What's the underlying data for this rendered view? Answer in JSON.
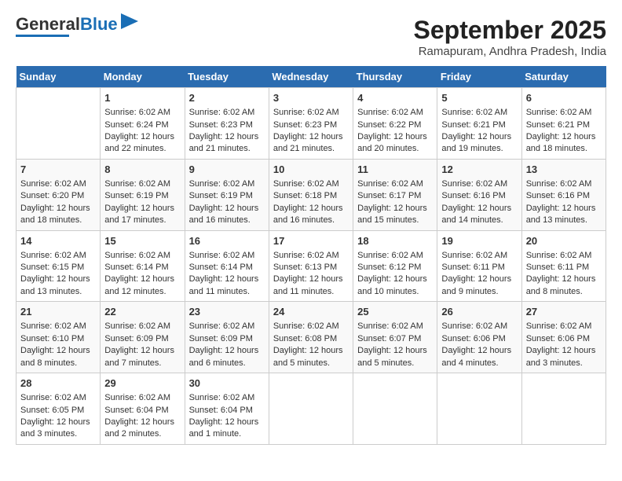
{
  "header": {
    "logo_general": "General",
    "logo_blue": "Blue",
    "title": "September 2025",
    "subtitle": "Ramapuram, Andhra Pradesh, India"
  },
  "days_of_week": [
    "Sunday",
    "Monday",
    "Tuesday",
    "Wednesday",
    "Thursday",
    "Friday",
    "Saturday"
  ],
  "weeks": [
    [
      {
        "day": "",
        "content": ""
      },
      {
        "day": "1",
        "content": "Sunrise: 6:02 AM\nSunset: 6:24 PM\nDaylight: 12 hours\nand 22 minutes."
      },
      {
        "day": "2",
        "content": "Sunrise: 6:02 AM\nSunset: 6:23 PM\nDaylight: 12 hours\nand 21 minutes."
      },
      {
        "day": "3",
        "content": "Sunrise: 6:02 AM\nSunset: 6:23 PM\nDaylight: 12 hours\nand 21 minutes."
      },
      {
        "day": "4",
        "content": "Sunrise: 6:02 AM\nSunset: 6:22 PM\nDaylight: 12 hours\nand 20 minutes."
      },
      {
        "day": "5",
        "content": "Sunrise: 6:02 AM\nSunset: 6:21 PM\nDaylight: 12 hours\nand 19 minutes."
      },
      {
        "day": "6",
        "content": "Sunrise: 6:02 AM\nSunset: 6:21 PM\nDaylight: 12 hours\nand 18 minutes."
      }
    ],
    [
      {
        "day": "7",
        "content": "Sunrise: 6:02 AM\nSunset: 6:20 PM\nDaylight: 12 hours\nand 18 minutes."
      },
      {
        "day": "8",
        "content": "Sunrise: 6:02 AM\nSunset: 6:19 PM\nDaylight: 12 hours\nand 17 minutes."
      },
      {
        "day": "9",
        "content": "Sunrise: 6:02 AM\nSunset: 6:19 PM\nDaylight: 12 hours\nand 16 minutes."
      },
      {
        "day": "10",
        "content": "Sunrise: 6:02 AM\nSunset: 6:18 PM\nDaylight: 12 hours\nand 16 minutes."
      },
      {
        "day": "11",
        "content": "Sunrise: 6:02 AM\nSunset: 6:17 PM\nDaylight: 12 hours\nand 15 minutes."
      },
      {
        "day": "12",
        "content": "Sunrise: 6:02 AM\nSunset: 6:16 PM\nDaylight: 12 hours\nand 14 minutes."
      },
      {
        "day": "13",
        "content": "Sunrise: 6:02 AM\nSunset: 6:16 PM\nDaylight: 12 hours\nand 13 minutes."
      }
    ],
    [
      {
        "day": "14",
        "content": "Sunrise: 6:02 AM\nSunset: 6:15 PM\nDaylight: 12 hours\nand 13 minutes."
      },
      {
        "day": "15",
        "content": "Sunrise: 6:02 AM\nSunset: 6:14 PM\nDaylight: 12 hours\nand 12 minutes."
      },
      {
        "day": "16",
        "content": "Sunrise: 6:02 AM\nSunset: 6:14 PM\nDaylight: 12 hours\nand 11 minutes."
      },
      {
        "day": "17",
        "content": "Sunrise: 6:02 AM\nSunset: 6:13 PM\nDaylight: 12 hours\nand 11 minutes."
      },
      {
        "day": "18",
        "content": "Sunrise: 6:02 AM\nSunset: 6:12 PM\nDaylight: 12 hours\nand 10 minutes."
      },
      {
        "day": "19",
        "content": "Sunrise: 6:02 AM\nSunset: 6:11 PM\nDaylight: 12 hours\nand 9 minutes."
      },
      {
        "day": "20",
        "content": "Sunrise: 6:02 AM\nSunset: 6:11 PM\nDaylight: 12 hours\nand 8 minutes."
      }
    ],
    [
      {
        "day": "21",
        "content": "Sunrise: 6:02 AM\nSunset: 6:10 PM\nDaylight: 12 hours\nand 8 minutes."
      },
      {
        "day": "22",
        "content": "Sunrise: 6:02 AM\nSunset: 6:09 PM\nDaylight: 12 hours\nand 7 minutes."
      },
      {
        "day": "23",
        "content": "Sunrise: 6:02 AM\nSunset: 6:09 PM\nDaylight: 12 hours\nand 6 minutes."
      },
      {
        "day": "24",
        "content": "Sunrise: 6:02 AM\nSunset: 6:08 PM\nDaylight: 12 hours\nand 5 minutes."
      },
      {
        "day": "25",
        "content": "Sunrise: 6:02 AM\nSunset: 6:07 PM\nDaylight: 12 hours\nand 5 minutes."
      },
      {
        "day": "26",
        "content": "Sunrise: 6:02 AM\nSunset: 6:06 PM\nDaylight: 12 hours\nand 4 minutes."
      },
      {
        "day": "27",
        "content": "Sunrise: 6:02 AM\nSunset: 6:06 PM\nDaylight: 12 hours\nand 3 minutes."
      }
    ],
    [
      {
        "day": "28",
        "content": "Sunrise: 6:02 AM\nSunset: 6:05 PM\nDaylight: 12 hours\nand 3 minutes."
      },
      {
        "day": "29",
        "content": "Sunrise: 6:02 AM\nSunset: 6:04 PM\nDaylight: 12 hours\nand 2 minutes."
      },
      {
        "day": "30",
        "content": "Sunrise: 6:02 AM\nSunset: 6:04 PM\nDaylight: 12 hours\nand 1 minute."
      },
      {
        "day": "",
        "content": ""
      },
      {
        "day": "",
        "content": ""
      },
      {
        "day": "",
        "content": ""
      },
      {
        "day": "",
        "content": ""
      }
    ]
  ]
}
